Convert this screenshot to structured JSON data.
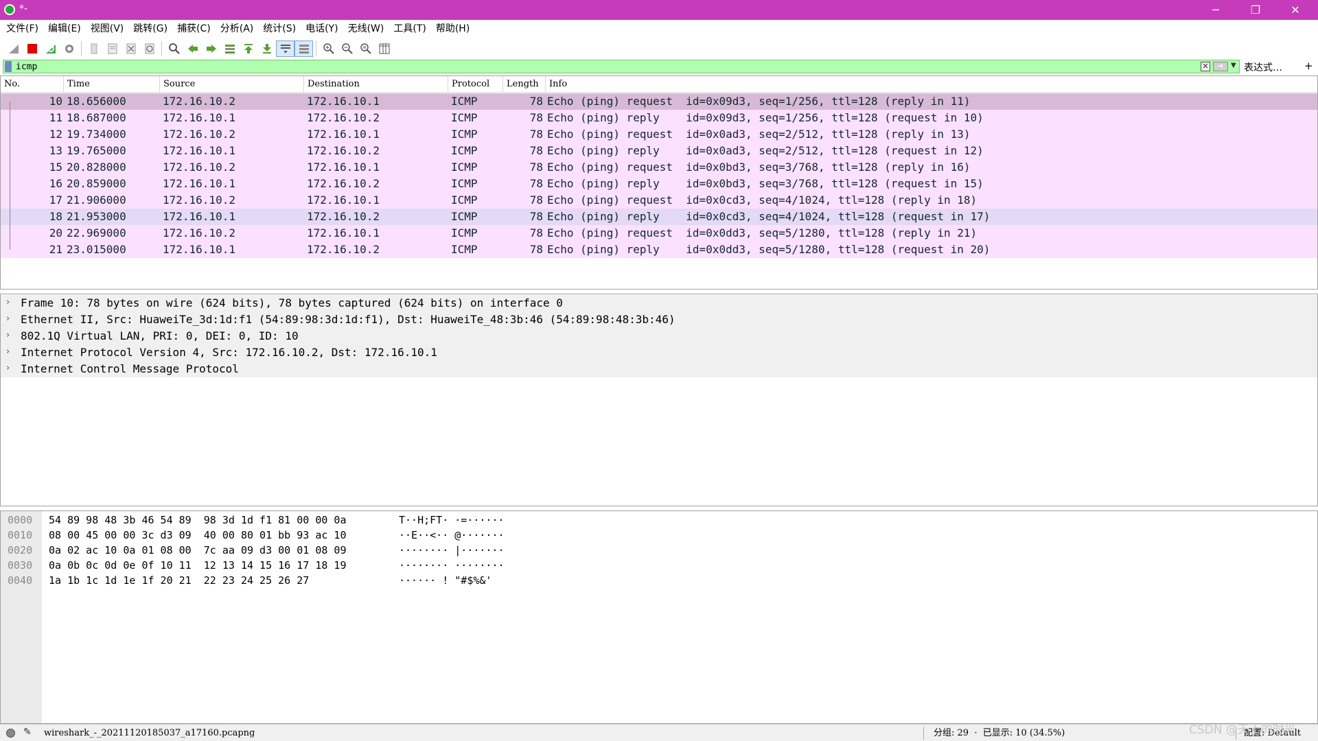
{
  "window": {
    "title": "*-",
    "minimize": "─",
    "restore": "❐",
    "close": "✕"
  },
  "menu": [
    "文件(F)",
    "编辑(E)",
    "视图(V)",
    "跳转(G)",
    "捕获(C)",
    "分析(A)",
    "统计(S)",
    "电话(Y)",
    "无线(W)",
    "工具(T)",
    "帮助(H)"
  ],
  "toolbar": {
    "icons": [
      "shark-fin-start-icon",
      "stop-capture-icon",
      "restart-capture-icon",
      "capture-options-icon",
      "open-file-icon",
      "save-file-icon",
      "close-file-icon",
      "reload-file-icon",
      "find-packet-icon",
      "go-back-icon",
      "go-forward-icon",
      "go-to-packet-icon",
      "go-first-icon",
      "go-last-icon",
      "auto-scroll-icon",
      "colorize-icon",
      "zoom-in-icon",
      "zoom-out-icon",
      "zoom-normal-icon",
      "resize-columns-icon"
    ]
  },
  "filter": {
    "value": "icmp",
    "expression_label": "表达式…",
    "add_label": "+"
  },
  "packet_list": {
    "columns": [
      "No.",
      "Time",
      "Source",
      "Destination",
      "Protocol",
      "Length",
      "Info"
    ],
    "rows": [
      {
        "no": "10",
        "time": "18.656000",
        "source": "172.16.10.2",
        "destination": "172.16.10.1",
        "protocol": "ICMP",
        "length": "78",
        "info": "Echo (ping) request  id=0x09d3, seq=1/256, ttl=128 (reply in 11)"
      },
      {
        "no": "11",
        "time": "18.687000",
        "source": "172.16.10.1",
        "destination": "172.16.10.2",
        "protocol": "ICMP",
        "length": "78",
        "info": "Echo (ping) reply    id=0x09d3, seq=1/256, ttl=128 (request in 10)"
      },
      {
        "no": "12",
        "time": "19.734000",
        "source": "172.16.10.2",
        "destination": "172.16.10.1",
        "protocol": "ICMP",
        "length": "78",
        "info": "Echo (ping) request  id=0x0ad3, seq=2/512, ttl=128 (reply in 13)"
      },
      {
        "no": "13",
        "time": "19.765000",
        "source": "172.16.10.1",
        "destination": "172.16.10.2",
        "protocol": "ICMP",
        "length": "78",
        "info": "Echo (ping) reply    id=0x0ad3, seq=2/512, ttl=128 (request in 12)"
      },
      {
        "no": "15",
        "time": "20.828000",
        "source": "172.16.10.2",
        "destination": "172.16.10.1",
        "protocol": "ICMP",
        "length": "78",
        "info": "Echo (ping) request  id=0x0bd3, seq=3/768, ttl=128 (reply in 16)"
      },
      {
        "no": "16",
        "time": "20.859000",
        "source": "172.16.10.1",
        "destination": "172.16.10.2",
        "protocol": "ICMP",
        "length": "78",
        "info": "Echo (ping) reply    id=0x0bd3, seq=3/768, ttl=128 (request in 15)"
      },
      {
        "no": "17",
        "time": "21.906000",
        "source": "172.16.10.2",
        "destination": "172.16.10.1",
        "protocol": "ICMP",
        "length": "78",
        "info": "Echo (ping) request  id=0x0cd3, seq=4/1024, ttl=128 (reply in 18)"
      },
      {
        "no": "18",
        "time": "21.953000",
        "source": "172.16.10.1",
        "destination": "172.16.10.2",
        "protocol": "ICMP",
        "length": "78",
        "info": "Echo (ping) reply    id=0x0cd3, seq=4/1024, ttl=128 (request in 17)"
      },
      {
        "no": "20",
        "time": "22.969000",
        "source": "172.16.10.2",
        "destination": "172.16.10.1",
        "protocol": "ICMP",
        "length": "78",
        "info": "Echo (ping) request  id=0x0dd3, seq=5/1280, ttl=128 (reply in 21)"
      },
      {
        "no": "21",
        "time": "23.015000",
        "source": "172.16.10.1",
        "destination": "172.16.10.2",
        "protocol": "ICMP",
        "length": "78",
        "info": "Echo (ping) reply    id=0x0dd3, seq=5/1280, ttl=128 (request in 20)"
      }
    ],
    "selected_row": 0,
    "highlighted_row": 7
  },
  "details": [
    "Frame 10: 78 bytes on wire (624 bits), 78 bytes captured (624 bits) on interface 0",
    "Ethernet II, Src: HuaweiTe_3d:1d:f1 (54:89:98:3d:1d:f1), Dst: HuaweiTe_48:3b:46 (54:89:98:48:3b:46)",
    "802.1Q Virtual LAN, PRI: 0, DEI: 0, ID: 10",
    "Internet Protocol Version 4, Src: 172.16.10.2, Dst: 172.16.10.1",
    "Internet Control Message Protocol"
  ],
  "bytes": [
    {
      "offset": "0000",
      "hex": "54 89 98 48 3b 46 54 89  98 3d 1d f1 81 00 00 0a",
      "ascii": "T··H;FT· ·=······"
    },
    {
      "offset": "0010",
      "hex": "08 00 45 00 00 3c d3 09  40 00 80 01 bb 93 ac 10",
      "ascii": "··E··<·· @·······"
    },
    {
      "offset": "0020",
      "hex": "0a 02 ac 10 0a 01 08 00  7c aa 09 d3 00 01 08 09",
      "ascii": "········ |·······"
    },
    {
      "offset": "0030",
      "hex": "0a 0b 0c 0d 0e 0f 10 11  12 13 14 15 16 17 18 19",
      "ascii": "········ ········"
    },
    {
      "offset": "0040",
      "hex": "1a 1b 1c 1d 1e 1f 20 21  22 23 24 25 26 27",
      "ascii": "······ ! \"#$%&'"
    }
  ],
  "status": {
    "file": "wireshark_-_20211120185037_a17160.pcapng",
    "stats": "分组: 29  ·  已显示: 10 (34.5%)",
    "profile": "配置: Default",
    "watermark": "CSDN @天上的时光"
  },
  "colors": {
    "titlebar": "#c53bb9",
    "filter_ok": "#afffaf",
    "icmp_row": "#fce0ff",
    "selected_row": "#d8bad6"
  }
}
